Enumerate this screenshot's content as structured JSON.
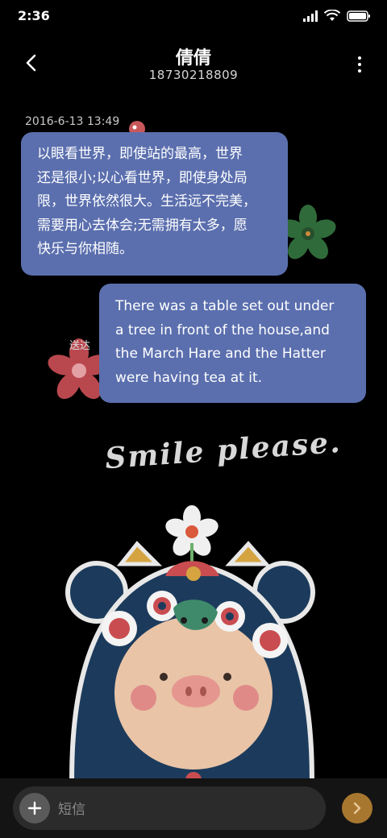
{
  "status_bar": {
    "time": "2:36",
    "icons": [
      "signal-icon",
      "wifi-icon",
      "battery-icon"
    ]
  },
  "header": {
    "contact_name": "倩倩",
    "phone_number": "18730218809",
    "back_icon": "back-arrow-icon",
    "menu_icon": "more-vertical-icon"
  },
  "conversation": {
    "timestamp": "2016-6-13 13:49",
    "messages": [
      {
        "direction": "incoming",
        "lines": [
          "以眼看世界，即使站的最高，世界",
          "还是很小;以心看世界，即使身处局",
          "限，世界依然很大。生活远不完美，",
          "需要用心去体会;无需拥有太多，愿",
          "快乐与你相随。"
        ]
      },
      {
        "direction": "outgoing",
        "lines": [
          "There was a table set out under",
          "a tree in front of the house,and",
          "the March Hare and the Hatter",
          "were having tea at it."
        ],
        "status": "送达"
      }
    ]
  },
  "wallpaper": {
    "text": "Smile please."
  },
  "compose": {
    "placeholder": "短信",
    "add_icon": "plus-icon",
    "send_icon": "send-arrow-icon"
  },
  "colors": {
    "bubble": "#5b6fae",
    "send_button": "#a8772f",
    "background": "#000000"
  }
}
